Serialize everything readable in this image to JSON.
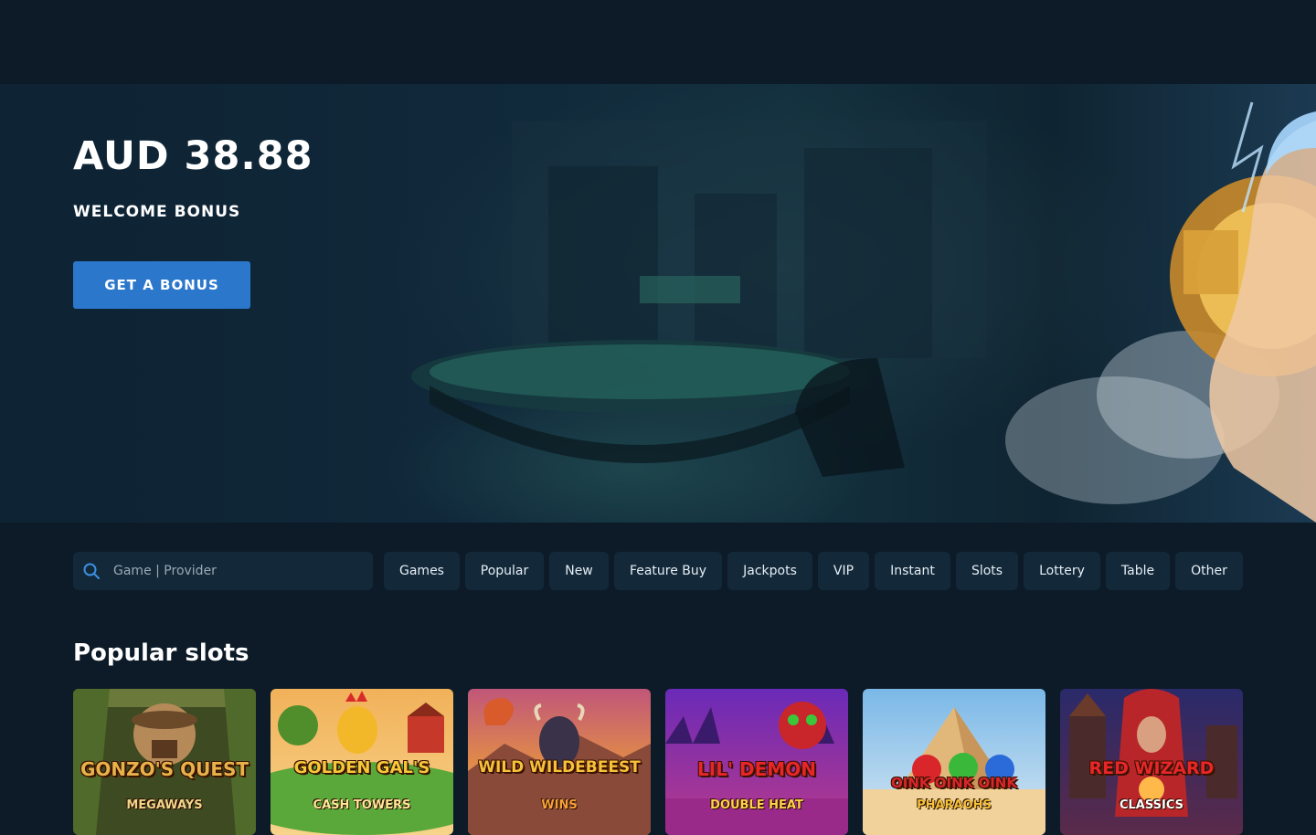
{
  "hero": {
    "amount": "AUD 38.88",
    "subtitle": "WELCOME BONUS",
    "cta_label": "GET A BONUS"
  },
  "search": {
    "placeholder": "Game | Provider"
  },
  "categories": [
    "Games",
    "Popular",
    "New",
    "Feature Buy",
    "Jackpots",
    "VIP",
    "Instant",
    "Slots",
    "Lottery",
    "Table",
    "Other"
  ],
  "section": {
    "title": "Popular slots"
  },
  "games": [
    {
      "title": "GONZO'S QUEST",
      "subtitle": "MEGAWAYS"
    },
    {
      "title": "GOLDEN GAL'S",
      "subtitle": "CASH TOWERS"
    },
    {
      "title": "WILD WILDEBEEST",
      "subtitle": "WINS"
    },
    {
      "title": "LIL' DEMON",
      "subtitle": "DOUBLE HEAT"
    },
    {
      "title": "OINK OINK OINK",
      "subtitle": "PHARAOHS"
    },
    {
      "title": "RED WIZARD",
      "subtitle": "CLASSICS"
    }
  ],
  "colors": {
    "page_bg": "#0c1b27",
    "surface": "#13293a",
    "accent": "#2a77cc",
    "text": "#ffffff"
  },
  "icons": {
    "search": "search-icon"
  }
}
